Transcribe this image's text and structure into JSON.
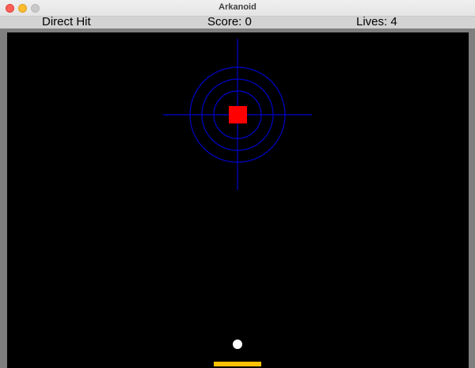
{
  "window": {
    "title": "Arkanoid"
  },
  "hud": {
    "level_name": "Direct Hit",
    "score_text": "Score: 0",
    "lives_text": "Lives: 4"
  },
  "colors": {
    "frame": "#7f7f7f",
    "hud_background": "#d3d3d3",
    "playfield": "#000000",
    "target_rings": "#0000cc",
    "block": "#ff0000",
    "ball": "#ffffff",
    "paddle": "#ffc107"
  },
  "icons": [
    "close-button-icon",
    "minimize-button-icon",
    "maximize-button-icon"
  ]
}
